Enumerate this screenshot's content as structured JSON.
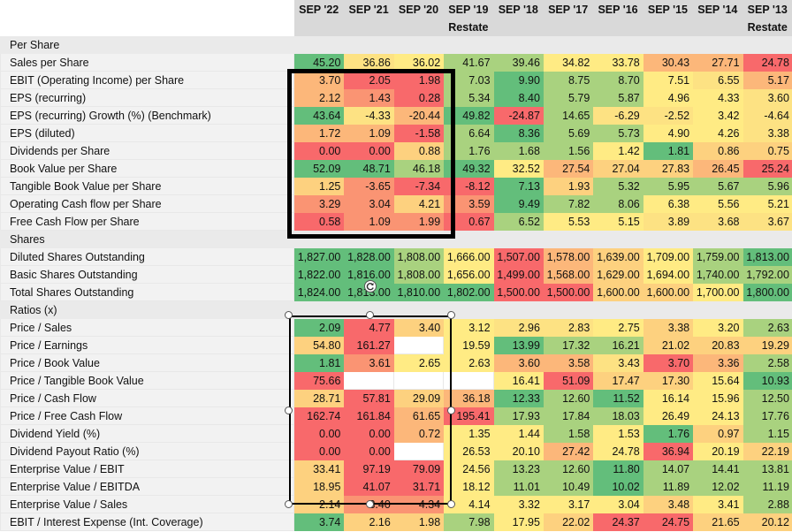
{
  "header": {
    "columns": [
      "SEP '22",
      "SEP '21",
      "SEP '20",
      "SEP '19",
      "SEP '18",
      "SEP '17",
      "SEP '16",
      "SEP '15",
      "SEP '14",
      "SEP '13"
    ],
    "restate": [
      "",
      "",
      "",
      "Restate",
      "",
      "",
      "",
      "",
      "",
      "Restate"
    ]
  },
  "rows": [
    {
      "label": "Per Share",
      "section": true
    },
    {
      "label": "Sales per Share",
      "values": [
        "45.20",
        "36.86",
        "36.02",
        "41.67",
        "39.46",
        "34.82",
        "33.78",
        "30.43",
        "27.71",
        "24.78"
      ]
    },
    {
      "label": "EBIT (Operating Income) per Share",
      "values": [
        "3.70",
        "2.05",
        "1.98",
        "7.03",
        "9.90",
        "8.75",
        "8.70",
        "7.51",
        "6.55",
        "5.17"
      ]
    },
    {
      "label": "EPS (recurring)",
      "values": [
        "2.12",
        "1.43",
        "0.28",
        "5.34",
        "8.40",
        "5.79",
        "5.87",
        "4.96",
        "4.33",
        "3.60"
      ]
    },
    {
      "label": "EPS (recurring) Growth (%) (Benchmark)",
      "values": [
        "43.64",
        "-4.33",
        "-20.44",
        "49.82",
        "-24.87",
        "14.65",
        "-6.29",
        "-2.52",
        "3.42",
        "-4.64"
      ]
    },
    {
      "label": "EPS (diluted)",
      "values": [
        "1.72",
        "1.09",
        "-1.58",
        "6.64",
        "8.36",
        "5.69",
        "5.73",
        "4.90",
        "4.26",
        "3.38"
      ]
    },
    {
      "label": "Dividends per Share",
      "values": [
        "0.00",
        "0.00",
        "0.88",
        "1.76",
        "1.68",
        "1.56",
        "1.42",
        "1.81",
        "0.86",
        "0.75"
      ]
    },
    {
      "label": "Book Value per Share",
      "values": [
        "52.09",
        "48.71",
        "46.18",
        "49.32",
        "32.52",
        "27.54",
        "27.04",
        "27.83",
        "26.45",
        "25.24"
      ]
    },
    {
      "label": "Tangible Book Value per Share",
      "values": [
        "1.25",
        "-3.65",
        "-7.34",
        "-8.12",
        "7.13",
        "1.93",
        "5.32",
        "5.95",
        "5.67",
        "5.96"
      ]
    },
    {
      "label": "Operating Cash flow per Share",
      "values": [
        "3.29",
        "3.04",
        "4.21",
        "3.59",
        "9.49",
        "7.82",
        "8.06",
        "6.38",
        "5.56",
        "5.21"
      ]
    },
    {
      "label": "Free Cash Flow per Share",
      "values": [
        "0.58",
        "1.09",
        "1.99",
        "0.67",
        "6.52",
        "5.53",
        "5.15",
        "3.89",
        "3.68",
        "3.67"
      ]
    },
    {
      "label": "Shares",
      "section": true
    },
    {
      "label": "Diluted Shares Outstanding",
      "values": [
        "1,827.00",
        "1,828.00",
        "1,808.00",
        "1,666.00",
        "1,507.00",
        "1,578.00",
        "1,639.00",
        "1,709.00",
        "1,759.00",
        "1,813.00"
      ]
    },
    {
      "label": "Basic Shares Outstanding",
      "values": [
        "1,822.00",
        "1,816.00",
        "1,808.00",
        "1,656.00",
        "1,499.00",
        "1,568.00",
        "1,629.00",
        "1,694.00",
        "1,740.00",
        "1,792.00"
      ]
    },
    {
      "label": "Total Shares Outstanding",
      "values": [
        "1,824.00",
        "1,813.00",
        "1,810.00",
        "1,802.00",
        "1,500.00",
        "1,500.00",
        "1,600.00",
        "1,600.00",
        "1,700.00",
        "1,800.00"
      ]
    },
    {
      "label": "Ratios (x)",
      "section": true
    },
    {
      "label": "Price / Sales",
      "values": [
        "2.09",
        "4.77",
        "3.40",
        "3.12",
        "2.96",
        "2.83",
        "2.75",
        "3.38",
        "3.20",
        "2.63"
      ]
    },
    {
      "label": "Price / Earnings",
      "values": [
        "54.80",
        "161.27",
        "",
        "19.59",
        "13.99",
        "17.32",
        "16.21",
        "21.02",
        "20.83",
        "19.29"
      ]
    },
    {
      "label": "Price / Book Value",
      "values": [
        "1.81",
        "3.61",
        "2.65",
        "2.63",
        "3.60",
        "3.58",
        "3.43",
        "3.70",
        "3.36",
        "2.58"
      ]
    },
    {
      "label": "Price / Tangible Book Value",
      "values": [
        "75.66",
        "",
        "",
        "",
        "16.41",
        "51.09",
        "17.47",
        "17.30",
        "15.64",
        "10.93"
      ]
    },
    {
      "label": "Price / Cash Flow",
      "values": [
        "28.71",
        "57.81",
        "29.09",
        "36.18",
        "12.33",
        "12.60",
        "11.52",
        "16.14",
        "15.96",
        "12.50"
      ]
    },
    {
      "label": "Price / Free Cash Flow",
      "values": [
        "162.74",
        "161.84",
        "61.65",
        "195.41",
        "17.93",
        "17.84",
        "18.03",
        "26.49",
        "24.13",
        "17.76"
      ]
    },
    {
      "label": "Dividend Yield (%)",
      "values": [
        "0.00",
        "0.00",
        "0.72",
        "1.35",
        "1.44",
        "1.58",
        "1.53",
        "1.76",
        "0.97",
        "1.15"
      ]
    },
    {
      "label": "Dividend Payout Ratio (%)",
      "values": [
        "0.00",
        "0.00",
        "",
        "26.53",
        "20.10",
        "27.42",
        "24.78",
        "36.94",
        "20.19",
        "22.19"
      ]
    },
    {
      "label": "Enterprise Value / EBIT",
      "values": [
        "33.41",
        "97.19",
        "79.09",
        "24.56",
        "13.23",
        "12.60",
        "11.80",
        "14.07",
        "14.41",
        "13.81"
      ]
    },
    {
      "label": "Enterprise Value / EBITDA",
      "values": [
        "18.95",
        "41.07",
        "31.71",
        "18.12",
        "11.01",
        "10.49",
        "10.02",
        "11.89",
        "12.02",
        "11.19"
      ]
    },
    {
      "label": "Enterprise Value / Sales",
      "values": [
        "2.14",
        "3.40",
        "4.34",
        "4.14",
        "3.32",
        "3.17",
        "3.04",
        "3.48",
        "3.41",
        "2.88"
      ]
    },
    {
      "label": "EBIT / Interest Expense (Int. Coverage)",
      "values": [
        "3.74",
        "2.16",
        "1.98",
        "7.98",
        "17.95",
        "22.02",
        "24.37",
        "24.75",
        "21.65",
        "20.12"
      ]
    }
  ],
  "colors": {
    "g": "#63be7b",
    "lg": "#a9d27f",
    "y": "#ffeb84",
    "yl": "#fde283",
    "o": "#fcb77a",
    "lo": "#fdd17f",
    "r": "#f8696b",
    "lr": "#fa9473"
  },
  "cellColors": [
    null,
    [
      "g",
      "yl",
      "y",
      "lg",
      "lg",
      "y",
      "y",
      "o",
      "o",
      "r"
    ],
    [
      "o",
      "r",
      "r",
      "lg",
      "g",
      "lg",
      "lg",
      "y",
      "yl",
      "o"
    ],
    [
      "o",
      "lr",
      "r",
      "lg",
      "g",
      "lg",
      "lg",
      "y",
      "y",
      "yl"
    ],
    [
      "g",
      "yl",
      "o",
      "g",
      "r",
      "lg",
      "yl",
      "yl",
      "y",
      "yl"
    ],
    [
      "o",
      "o",
      "r",
      "lg",
      "g",
      "lg",
      "lg",
      "y",
      "y",
      "yl"
    ],
    [
      "r",
      "r",
      "lo",
      "lg",
      "lg",
      "lg",
      "y",
      "g",
      "lo",
      "lo"
    ],
    [
      "g",
      "g",
      "lg",
      "g",
      "y",
      "o",
      "lo",
      "lo",
      "o",
      "r"
    ],
    [
      "lo",
      "lr",
      "r",
      "r",
      "g",
      "lo",
      "lg",
      "lg",
      "lg",
      "lg"
    ],
    [
      "lr",
      "lr",
      "lo",
      "lr",
      "g",
      "lg",
      "lg",
      "y",
      "y",
      "y"
    ],
    [
      "r",
      "lr",
      "lr",
      "r",
      "lg",
      "y",
      "y",
      "yl",
      "yl",
      "yl"
    ],
    null,
    [
      "g",
      "g",
      "lg",
      "y",
      "r",
      "o",
      "lo",
      "y",
      "lg",
      "g"
    ],
    [
      "g",
      "g",
      "lg",
      "y",
      "r",
      "o",
      "lo",
      "y",
      "lg",
      "lg"
    ],
    [
      "g",
      "g",
      "g",
      "g",
      "r",
      "r",
      "lo",
      "lo",
      "y",
      "g"
    ],
    null,
    [
      "g",
      "r",
      "lo",
      "y",
      "yl",
      "yl",
      "y",
      "lo",
      "y",
      "lg"
    ],
    [
      "lo",
      "r",
      "blank",
      "y",
      "g",
      "lg",
      "lg",
      "lo",
      "lo",
      "lo"
    ],
    [
      "g",
      "lr",
      "y",
      "y",
      "o",
      "o",
      "yl",
      "r",
      "o",
      "lg"
    ],
    [
      "r",
      "blank",
      "blank",
      "blank",
      "y",
      "r",
      "lo",
      "lo",
      "y",
      "g"
    ],
    [
      "lo",
      "r",
      "lo",
      "o",
      "g",
      "lg",
      "g",
      "y",
      "y",
      "lg"
    ],
    [
      "r",
      "r",
      "o",
      "r",
      "lg",
      "lg",
      "lg",
      "y",
      "y",
      "lg"
    ],
    [
      "r",
      "r",
      "o",
      "y",
      "y",
      "lg",
      "y",
      "g",
      "lo",
      "lg"
    ],
    [
      "r",
      "r",
      "blank",
      "y",
      "y",
      "o",
      "y",
      "r",
      "y",
      "lo"
    ],
    [
      "lo",
      "r",
      "r",
      "y",
      "lg",
      "lg",
      "g",
      "lg",
      "lg",
      "lg"
    ],
    [
      "lo",
      "r",
      "r",
      "y",
      "lg",
      "lg",
      "g",
      "lg",
      "lg",
      "lg"
    ],
    [
      "lo",
      "lr",
      "lr",
      "y",
      "y",
      "y",
      "y",
      "lo",
      "y",
      "lg"
    ],
    [
      "g",
      "lo",
      "lo",
      "lg",
      "y",
      "lo",
      "r",
      "r",
      "lo",
      "lo"
    ]
  ]
}
